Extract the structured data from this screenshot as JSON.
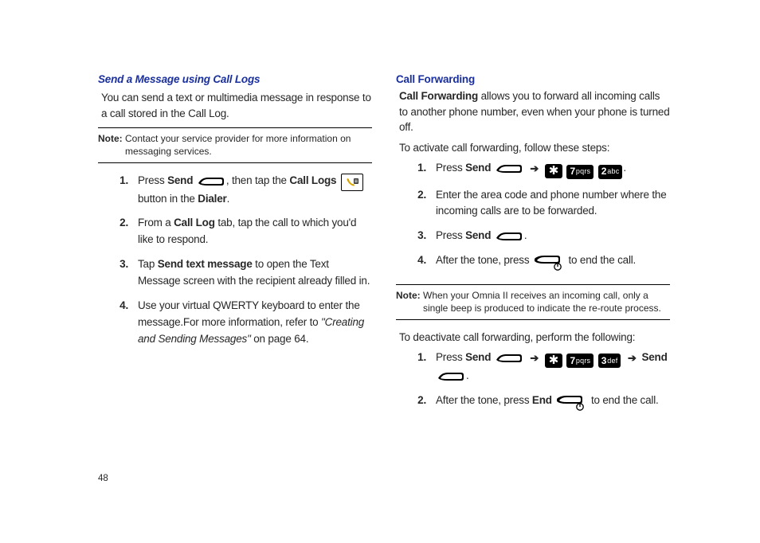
{
  "page_number": "48",
  "left": {
    "heading": "Send a Message using Call Logs",
    "intro": "You can send a text or multimedia message in response to a call stored in the Call Log.",
    "note_label": "Note: ",
    "note_body": "Contact your service provider for more information on messaging services.",
    "steps": [
      {
        "num": "1.",
        "pre": "Press ",
        "b1": "Send",
        "mid": ", then tap the ",
        "b2": "Call Logs",
        "post": " button in the ",
        "b3": "Dialer",
        "tail": "."
      },
      {
        "num": "2.",
        "pre": "From a ",
        "b1": "Call Log",
        "post": " tab, tap the call to which you'd like to respond."
      },
      {
        "num": "3.",
        "pre": "Tap ",
        "b1": "Send text message",
        "post": " to open the Text Message screen with the recipient already filled in."
      },
      {
        "num": "4.",
        "pre": "Use your virtual QWERTY keyboard to enter the message.For more information, refer to ",
        "i1": "\"Creating and Sending Messages\" ",
        "post": " on page 64."
      }
    ]
  },
  "right": {
    "heading": "Call Forwarding",
    "intro_b": "Call Forwarding",
    "intro_rest": " allows you to forward all incoming calls to another phone number, even when your phone is turned off.",
    "activate_lead": "To activate call forwarding, follow these steps:",
    "activate_steps": [
      {
        "num": "1.",
        "pre": "Press ",
        "b1": "Send",
        "tail": "."
      },
      {
        "num": "2.",
        "text": "Enter the area code and phone number where the incoming calls are to be forwarded."
      },
      {
        "num": "3.",
        "pre": "Press ",
        "b1": "Send",
        "tail": "."
      },
      {
        "num": "4.",
        "pre": "After the tone, press ",
        "tail": " to end the call."
      }
    ],
    "note_label": "Note: ",
    "note_body": "When your Omnia II receives an incoming call, only a single beep is produced to indicate the re-route process.",
    "deactivate_lead": "To deactivate call forwarding, perform the following:",
    "deactivate_steps": [
      {
        "num": "1.",
        "pre": "Press ",
        "b1": "Send",
        "b2": "Send",
        "tail": "."
      },
      {
        "num": "2.",
        "pre": "After the tone, press ",
        "b1": "End",
        "tail": " to end the call."
      }
    ],
    "key_7": {
      "n": "7",
      "l": "pqrs"
    },
    "key_2": {
      "n": "2",
      "l": "abc"
    },
    "key_3": {
      "n": "3",
      "l": "def"
    }
  }
}
